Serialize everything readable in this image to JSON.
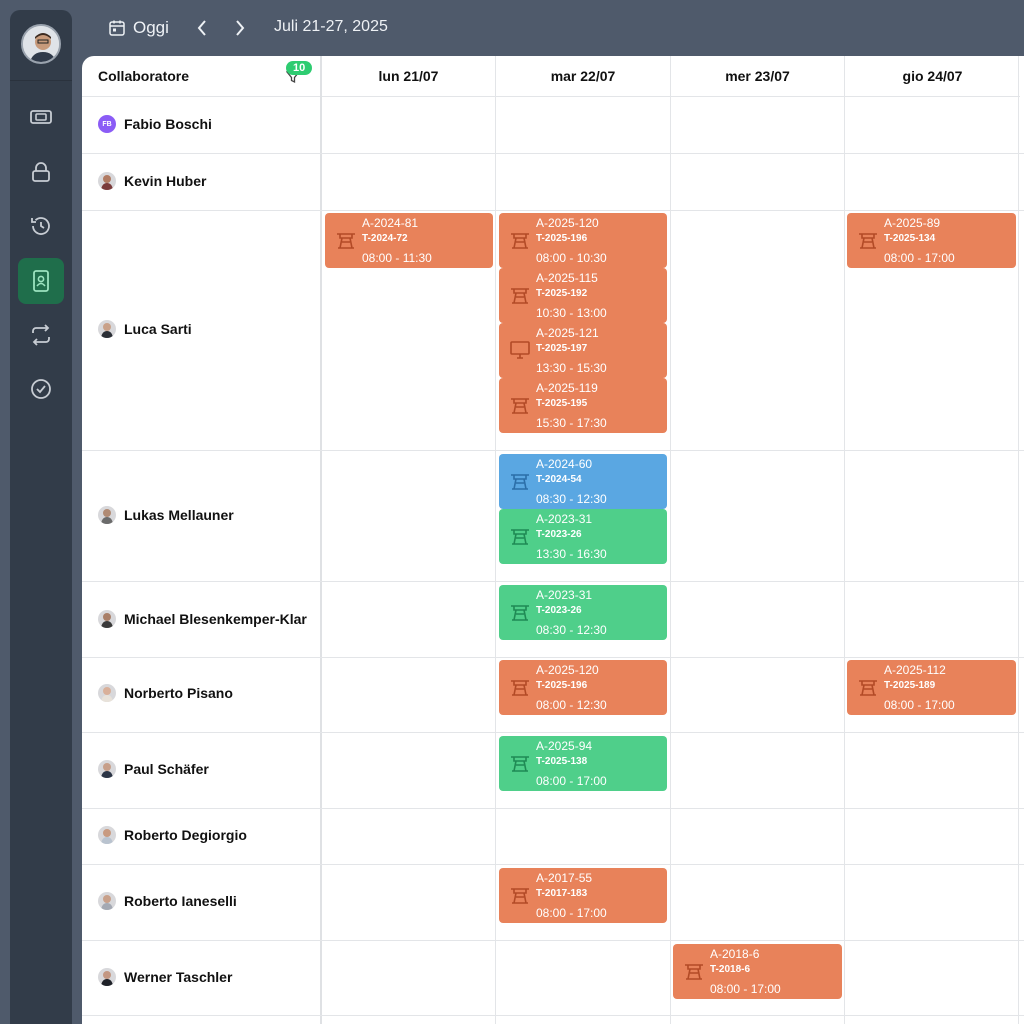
{
  "toolbar": {
    "today_label": "Oggi",
    "prev_icon": "chevron-left-icon",
    "next_icon": "chevron-right-icon",
    "date_range": "Juli 21-27, 2025"
  },
  "sidebar": {
    "items": [
      {
        "icon": "ticket-icon",
        "active": false
      },
      {
        "icon": "lock-icon",
        "active": false
      },
      {
        "icon": "history-icon",
        "active": false
      },
      {
        "icon": "contact-card-icon",
        "active": true
      },
      {
        "icon": "repeat-icon",
        "active": false
      },
      {
        "icon": "check-circle-icon",
        "active": false
      }
    ],
    "active_color": "#1f6e4b"
  },
  "grid": {
    "column_header": "Collaboratore",
    "filter_count": "10",
    "days": [
      "lun 21/07",
      "mar 22/07",
      "mer 23/07",
      "gio 24/07"
    ],
    "employees": [
      {
        "name": "Fabio Boschi",
        "initials": "FB"
      },
      {
        "name": "Kevin Huber"
      },
      {
        "name": "Luca Sarti"
      },
      {
        "name": "Lukas Mellauner"
      },
      {
        "name": "Michael Blesenkemper-Klar"
      },
      {
        "name": "Norberto Pisano"
      },
      {
        "name": "Paul Schäfer"
      },
      {
        "name": "Roberto Degiorgio"
      },
      {
        "name": "Roberto Ianeselli"
      },
      {
        "name": "Werner Taschler"
      }
    ]
  },
  "events": [
    {
      "title": "A-2024-81",
      "ticket": "T-2024-72",
      "time": "08:00 - 11:30",
      "color": "orange",
      "icon": "crane-icon"
    },
    {
      "title": "A-2025-120",
      "ticket": "T-2025-196",
      "time": "08:00 - 10:30",
      "color": "orange",
      "icon": "crane-icon"
    },
    {
      "title": "A-2025-115",
      "ticket": "T-2025-192",
      "time": "10:30 - 13:00",
      "color": "orange",
      "icon": "crane-icon"
    },
    {
      "title": "A-2025-121",
      "ticket": "T-2025-197",
      "time": "13:30 - 15:30",
      "color": "orange",
      "icon": "monitor-icon"
    },
    {
      "title": "A-2025-119",
      "ticket": "T-2025-195",
      "time": "15:30 - 17:30",
      "color": "orange",
      "icon": "crane-icon"
    },
    {
      "title": "A-2025-89",
      "ticket": "T-2025-134",
      "time": "08:00 - 17:00",
      "color": "orange",
      "icon": "crane-icon"
    },
    {
      "title": "A-2024-60",
      "ticket": "T-2024-54",
      "time": "08:30 - 12:30",
      "color": "blue",
      "icon": "crane-icon"
    },
    {
      "title": "A-2023-31",
      "ticket": "T-2023-26",
      "time": "13:30 - 16:30",
      "color": "green",
      "icon": "crane-icon"
    },
    {
      "title": "A-2023-31",
      "ticket": "T-2023-26",
      "time": "08:30 - 12:30",
      "color": "green",
      "icon": "crane-icon"
    },
    {
      "title": "A-2025-120",
      "ticket": "T-2025-196",
      "time": "08:00 - 12:30",
      "color": "orange",
      "icon": "crane-icon"
    },
    {
      "title": "A-2025-112",
      "ticket": "T-2025-189",
      "time": "08:00 - 17:00",
      "color": "orange",
      "icon": "crane-icon"
    },
    {
      "title": "A-2025-94",
      "ticket": "T-2025-138",
      "time": "08:00 - 17:00",
      "color": "green",
      "icon": "crane-icon"
    },
    {
      "title": "A-2017-55",
      "ticket": "T-2017-183",
      "time": "08:00 - 17:00",
      "color": "orange",
      "icon": "crane-icon"
    },
    {
      "title": "A-2018-6",
      "ticket": "T-2018-6",
      "time": "08:00 - 17:00",
      "color": "orange",
      "icon": "crane-icon"
    }
  ]
}
